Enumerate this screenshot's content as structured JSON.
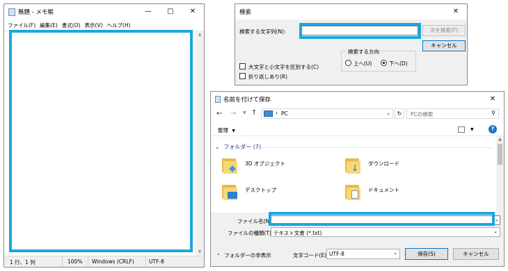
{
  "notepad": {
    "title": "無題 - メモ帳",
    "menu": [
      "ファイル(F)",
      "編集(E)",
      "書式(O)",
      "表示(V)",
      "ヘルプ(H)"
    ],
    "status": {
      "position": "1 行、1 列",
      "zoom": "100%",
      "eol": "Windows (CRLF)",
      "encoding": "UTF-8"
    }
  },
  "find": {
    "title": "検索",
    "label": "検索する文字列(N):",
    "search_value": "",
    "find_next": "次を検索(F)",
    "cancel": "キャンセル",
    "direction_label": "検索する方向",
    "up": "上へ(U)",
    "down": "下へ(D)",
    "case_sensitive": "大文字と小文字を区別する(C)",
    "wrap": "折り返しあり(R)"
  },
  "save": {
    "title": "名前を付けて保存",
    "path": "PC",
    "search_placeholder": "PCの検索",
    "organize": "整理",
    "group": "フォルダー (7)",
    "items": [
      "3D オブジェクト",
      "ダウンロード",
      "デスクトップ",
      "ドキュメント"
    ],
    "filename_label": "ファイル名(N):",
    "filename_value": "",
    "type_label": "ファイルの種類(T):",
    "type_value": "テキスト文書 (*.txt)",
    "hide_folders": "フォルダーの非表示",
    "encoding_label": "文字コード(E):",
    "encoding_value": "UTF-8",
    "save_btn": "保存(S)",
    "cancel_btn": "キャンセル"
  },
  "colors": {
    "highlight": "#1aa7e0",
    "accent": "#0078d7",
    "folder": "#f8d775"
  },
  "icons": [
    "notepad-icon",
    "minimize-icon",
    "maximize-icon",
    "close-icon",
    "back-arrow-icon",
    "forward-arrow-icon",
    "up-arrow-icon",
    "refresh-icon",
    "search-icon",
    "pc-icon",
    "help-icon",
    "view-icon",
    "folder-icon"
  ]
}
